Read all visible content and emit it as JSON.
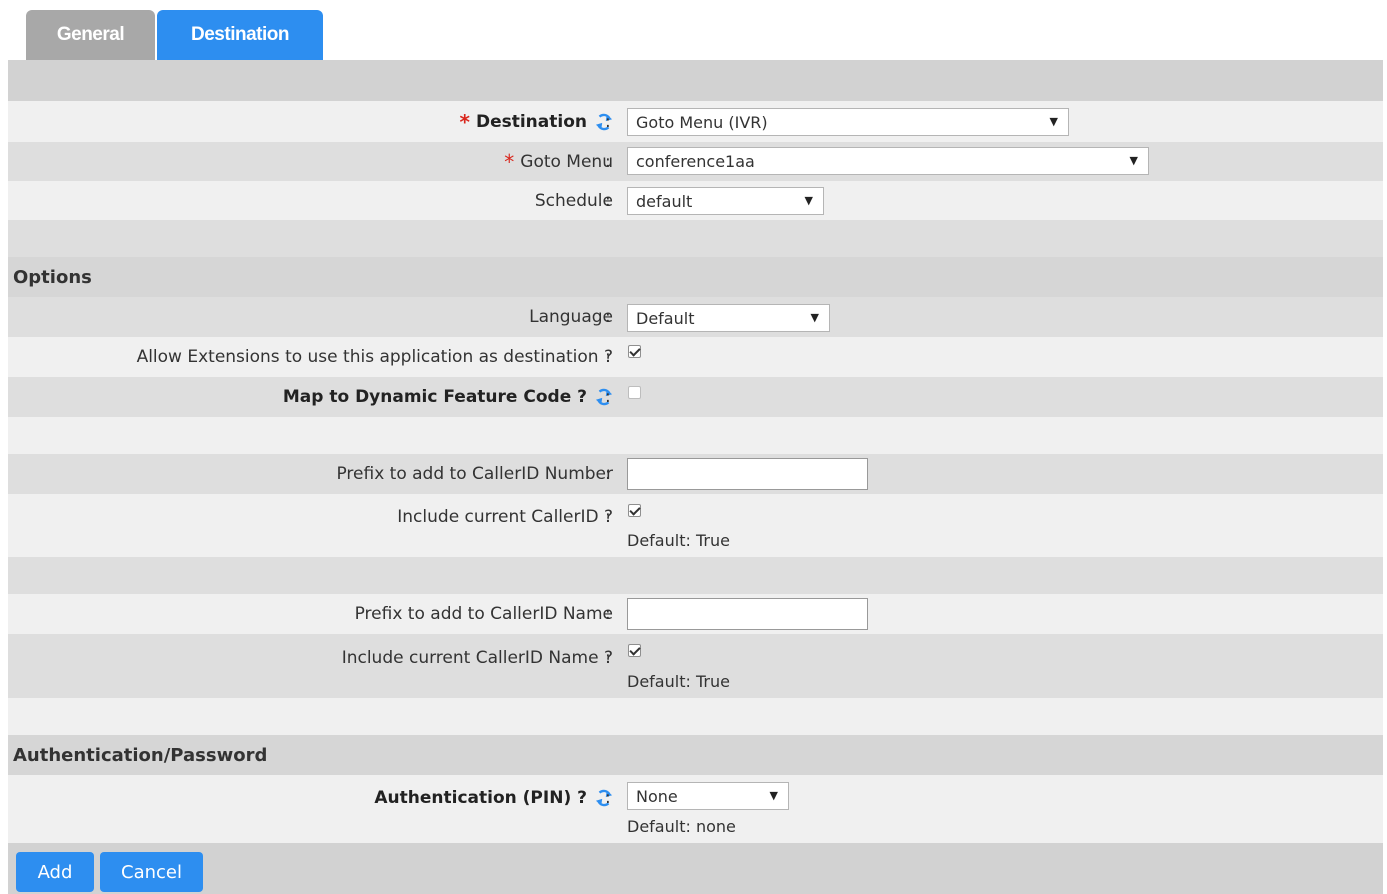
{
  "tabs": [
    {
      "label": "General",
      "active": false
    },
    {
      "label": "Destination",
      "active": true
    }
  ],
  "destination_section": {
    "destination": {
      "label": "Destination",
      "required": true,
      "value": "Goto Menu (IVR)"
    },
    "goto_menu": {
      "label": "Goto Menu",
      "required": true,
      "value": "conference1aa"
    },
    "schedule": {
      "label": "Schedule",
      "value": "default"
    }
  },
  "options": {
    "title": "Options",
    "language": {
      "label": "Language",
      "value": "Default"
    },
    "allow_extensions": {
      "label": "Allow Extensions to use this application as destination ?",
      "checked": true
    },
    "map_feature_code": {
      "label": "Map to Dynamic Feature Code ?",
      "checked": false
    },
    "prefix_number": {
      "label": "Prefix to add to CallerID Number",
      "value": ""
    },
    "include_callerid": {
      "label": "Include current CallerID ?",
      "checked": true,
      "hint": "Default: True"
    },
    "prefix_name": {
      "label": "Prefix to add to CallerID Name",
      "value": ""
    },
    "include_callerid_name": {
      "label": "Include current CallerID Name ?",
      "checked": true,
      "hint": "Default: True"
    }
  },
  "auth": {
    "title": "Authentication/Password",
    "pin": {
      "label": "Authentication (PIN) ?",
      "value": "None",
      "hint": "Default: none"
    }
  },
  "buttons": {
    "add": "Add",
    "cancel": "Cancel"
  },
  "colon": ":",
  "colors": {
    "accent": "#2d8ef0",
    "required": "#d9261c",
    "tab_inactive": "#a8a8a8"
  },
  "icons": {
    "refresh": "refresh-icon",
    "dropdown": "triangle-down-icon",
    "required": "asterisk-icon"
  }
}
